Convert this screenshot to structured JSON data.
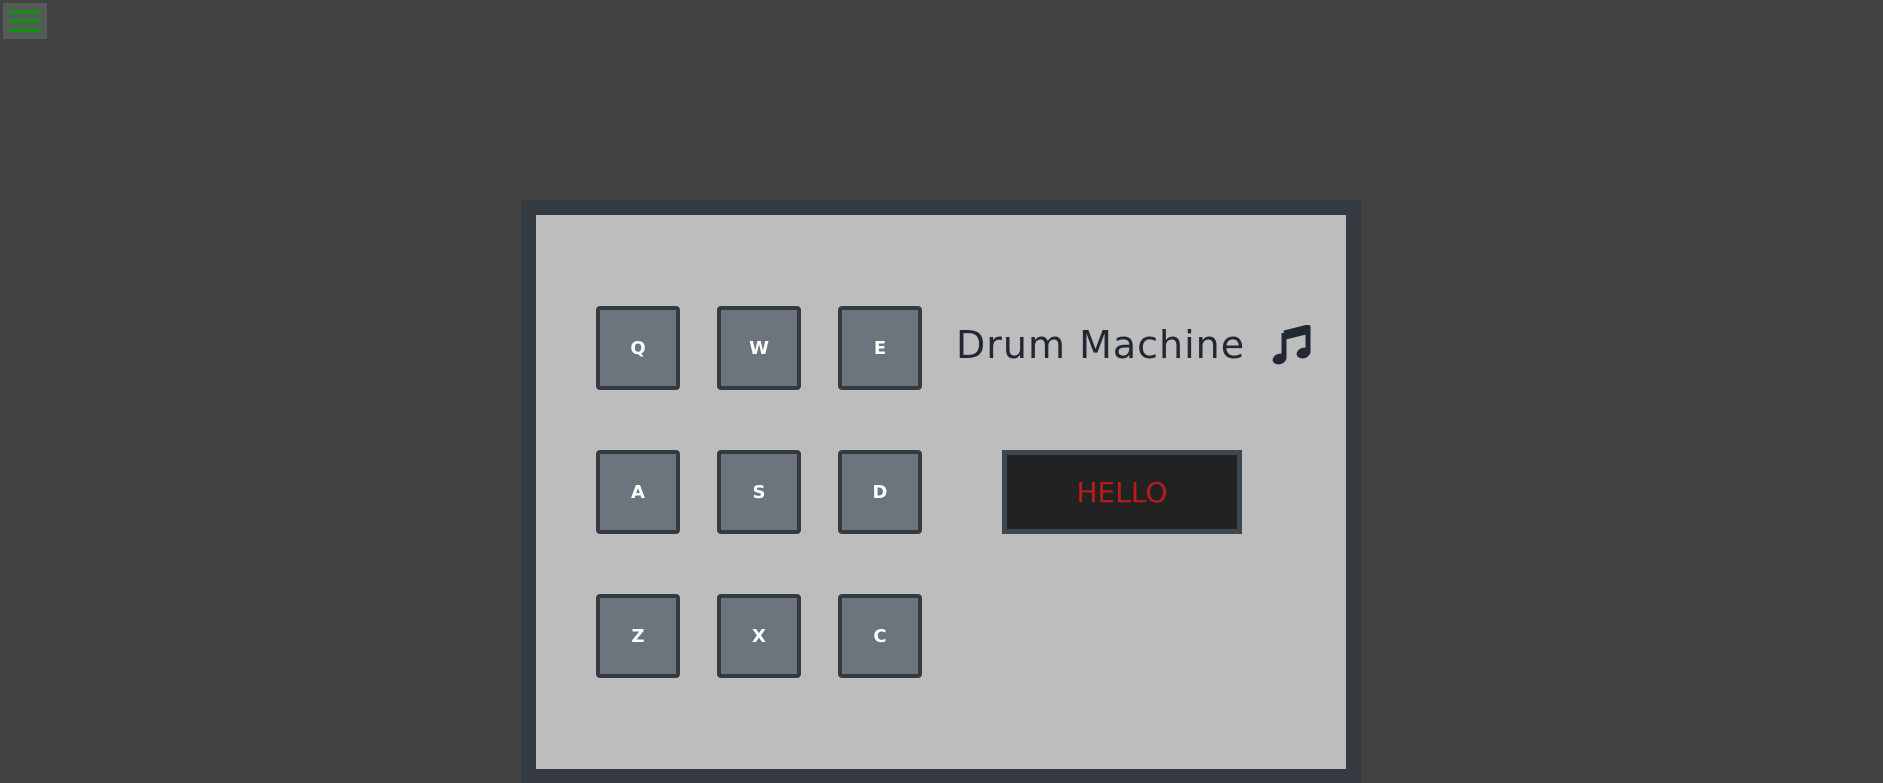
{
  "menu": {
    "icon": "hamburger-menu-icon",
    "color": "#1d8a1d"
  },
  "app": {
    "title": "Drum Machine",
    "title_icon": "music-note-icon",
    "display_text": "HELLO",
    "display_color": "#b71c1c"
  },
  "pads": [
    {
      "key": "Q"
    },
    {
      "key": "W"
    },
    {
      "key": "E"
    },
    {
      "key": "A"
    },
    {
      "key": "S"
    },
    {
      "key": "D"
    },
    {
      "key": "Z"
    },
    {
      "key": "X"
    },
    {
      "key": "C"
    }
  ]
}
